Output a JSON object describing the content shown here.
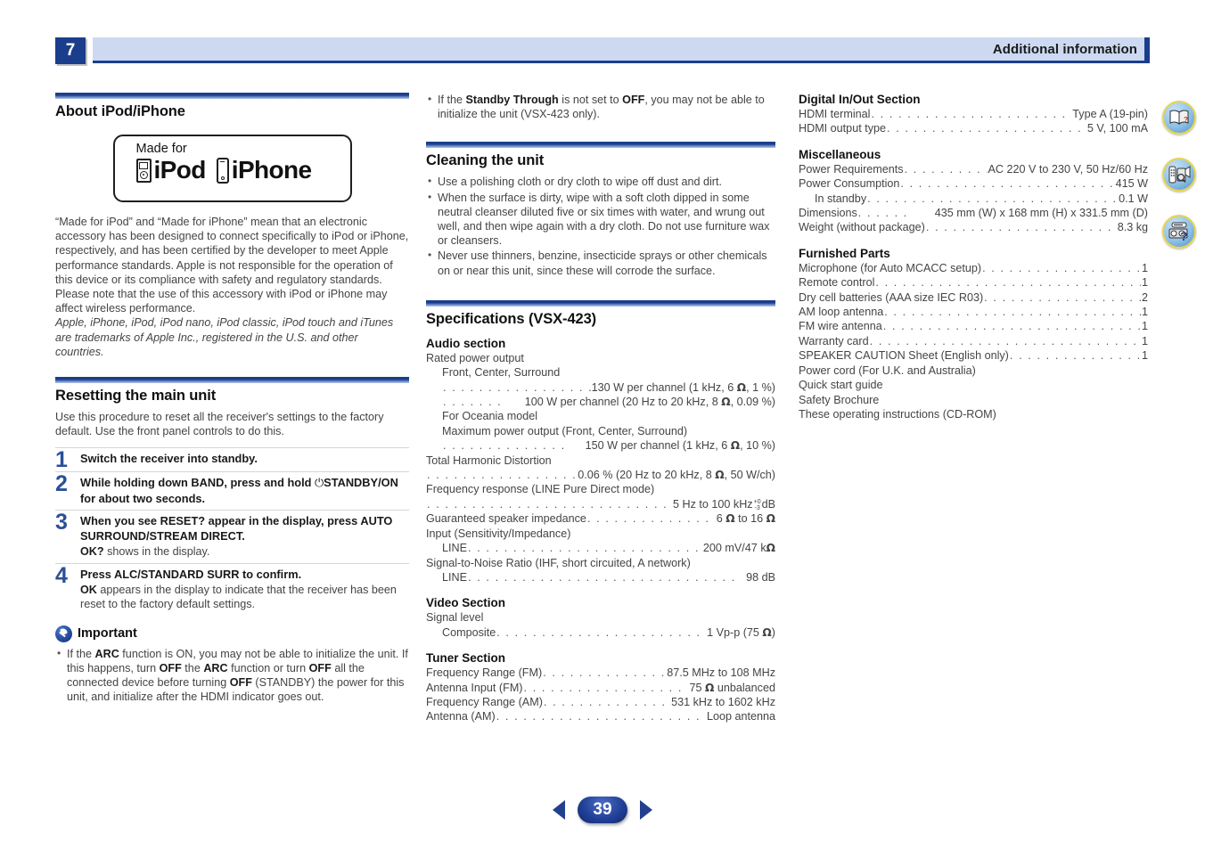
{
  "header": {
    "chapter_number": "7",
    "title": "Additional information"
  },
  "colors": {
    "accent_dark_blue": "#1b3e8c",
    "band_light_blue": "#ccd9f1",
    "step_number_blue": "#2a5099",
    "icon_ring_yellow": "#e8d54a"
  },
  "column1": {
    "section_title": "About iPod/iPhone",
    "logo": {
      "made_for": "Made for",
      "ipod_word": "iPod",
      "iphone_word": "iPhone"
    },
    "paragraph": "“Made for iPod” and “Made for iPhone” mean that an electronic accessory has been designed to connect specifically to iPod or iPhone, respectively, and has been certified by the developer to meet Apple performance standards. Apple is not responsible for the operation of this device or its compliance with safety and regulatory standards. Please note that the use of this accessory with iPod or iPhone may affect wireless performance.",
    "trademark_note": "Apple, iPhone, iPod, iPod nano, iPod classic, iPod touch and iTunes are trademarks of Apple Inc., registered in the U.S. and other countries.",
    "reset": {
      "section_title": "Resetting the main unit",
      "intro": "Use this procedure to reset all the receiver's settings to the factory default. Use the front panel controls to do this.",
      "steps": [
        {
          "num": "1",
          "head": "Switch the receiver into standby.",
          "note": ""
        },
        {
          "num": "2",
          "head": "While holding down BAND, press and hold ⏼STANDBY/ON for about two seconds.",
          "note": ""
        },
        {
          "num": "3",
          "head": "When you see RESET? appear in the display, press AUTO SURROUND/STREAM DIRECT.",
          "note": "OK? shows in the display."
        },
        {
          "num": "4",
          "head": "Press ALC/STANDARD SURR to confirm.",
          "note": "OK appears in the display to indicate that the receiver has been reset to the factory default settings."
        }
      ],
      "important_label": "Important",
      "important_bullets": [
        "If the ARC function is ON, you may not be able to initialize the unit. If this happens, turn OFF the ARC function or turn OFF all the connected device before turning OFF (STANDBY) the power for this unit, and initialize after the HDMI indicator goes out."
      ]
    }
  },
  "column2": {
    "top_bullets": [
      "If the Standby Through is not set to OFF, you may not be able to initialize the unit (VSX-423 only)."
    ],
    "cleaning": {
      "section_title": "Cleaning the unit",
      "bullets": [
        "Use a polishing cloth or dry cloth to wipe off dust and dirt.",
        "When the surface is dirty, wipe with a soft cloth dipped in some neutral cleanser diluted five or six times with water, and wrung out well, and then wipe again with a dry cloth. Do not use furniture wax or cleansers.",
        "Never use thinners, benzine, insecticide sprays or other chemicals on or near this unit, since these will corrode the surface."
      ]
    },
    "specifications": {
      "section_title": "Specifications (VSX-423)",
      "audio": {
        "heading": "Audio section",
        "l_rated": "Rated power output",
        "l_fcs": "Front, Center, Surround",
        "v_130": "130 W per channel (1 kHz, 6 Ω, 1 %)",
        "v_100": "100 W per channel (20 Hz to 20 kHz, 8 Ω, 0.09 %)",
        "l_oceania": "For Oceania model",
        "l_maxpower": "Maximum power output (Front, Center, Surround)",
        "v_150": "150 W per channel (1 kHz, 6 Ω, 10 %)",
        "l_thd": "Total Harmonic Distortion",
        "v_thd": "0.06 % (20 Hz to 20 kHz, 8 Ω, 50 W/ch)",
        "l_freqresp": "Frequency response (LINE Pure Direct mode)",
        "v_freqresp": "5 Hz to 100 kHz",
        "v_freqresp_tol_top": "+0",
        "v_freqresp_tol_bot": "-3",
        "v_freqresp_unit": "dB",
        "l_speakerimp": "Guaranteed speaker impedance",
        "v_speakerimp": "6 Ω to 16 Ω",
        "l_input": "Input (Sensitivity/Impedance)",
        "l_line1": "LINE",
        "v_line1": "200 mV/47 kΩ",
        "l_snr": "Signal-to-Noise Ratio (IHF, short circuited, A network)",
        "l_line2": "LINE",
        "v_line2": "98 dB"
      },
      "video": {
        "heading": "Video Section",
        "l_signal": "Signal level",
        "l_composite": "Composite",
        "v_composite": "1 Vp-p (75 Ω)"
      },
      "tuner": {
        "heading": "Tuner Section",
        "rows": [
          {
            "label": "Frequency Range (FM)",
            "value": "87.5 MHz to 108 MHz"
          },
          {
            "label": "Antenna Input (FM)",
            "value": "75 Ω unbalanced"
          },
          {
            "label": "Frequency Range (AM)",
            "value": "531 kHz to 1602 kHz"
          },
          {
            "label": "Antenna (AM)",
            "value": "Loop antenna"
          }
        ]
      }
    }
  },
  "column3": {
    "digital": {
      "heading": "Digital In/Out Section",
      "rows": [
        {
          "label": "HDMI terminal",
          "value": "Type A (19-pin)"
        },
        {
          "label": "HDMI output type",
          "value": "5 V, 100 mA"
        }
      ]
    },
    "misc": {
      "heading": "Miscellaneous",
      "rows": [
        {
          "label": "Power Requirements",
          "value": "AC 220 V to 230 V, 50 Hz/60 Hz",
          "indent": false
        },
        {
          "label": "Power Consumption",
          "value": "415 W",
          "indent": false
        },
        {
          "label": "In standby",
          "value": "0.1 W",
          "indent": true
        },
        {
          "label": "Dimensions",
          "value": "435 mm (W) x 168 mm (H) x 331.5 mm (D)",
          "indent": false
        },
        {
          "label": "Weight (without package)",
          "value": "8.3 kg",
          "indent": false
        }
      ]
    },
    "furnished": {
      "heading": "Furnished Parts",
      "rows": [
        {
          "label": "Microphone (for Auto MCACC setup)",
          "value": "1"
        },
        {
          "label": "Remote control",
          "value": "1"
        },
        {
          "label": "Dry cell batteries (AAA size IEC R03)",
          "value": "2"
        },
        {
          "label": "AM loop antenna",
          "value": "1"
        },
        {
          "label": "FM wire antenna",
          "value": "1"
        },
        {
          "label": "Warranty card",
          "value": "1"
        },
        {
          "label": "SPEAKER CAUTION Sheet (English only)",
          "value": "1"
        }
      ],
      "plain_rows": [
        "Power cord (For U.K. and Australia)",
        "Quick start guide",
        "Safety Brochure",
        "These operating instructions (CD-ROM)"
      ]
    }
  },
  "edge_icons": [
    {
      "name": "manual-book-icon"
    },
    {
      "name": "remote-control-icon"
    },
    {
      "name": "faq-troubleshooting-icon"
    }
  ],
  "footer": {
    "page_number": "39",
    "prev_label": "◀",
    "next_label": "▶"
  }
}
